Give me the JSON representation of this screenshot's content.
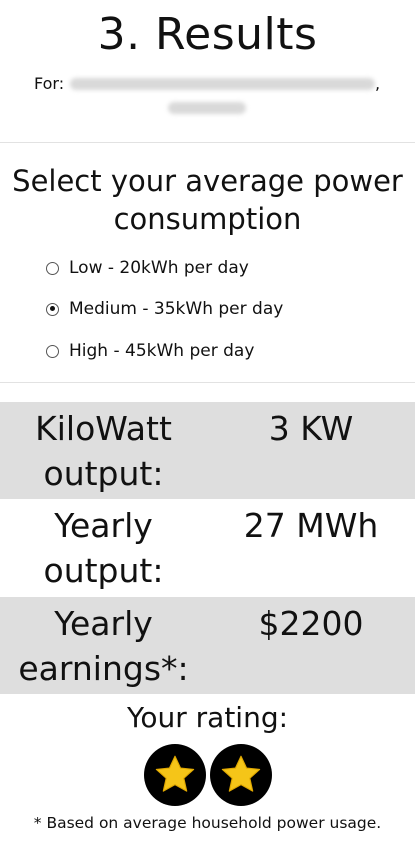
{
  "header": {
    "title": "3. Results",
    "for_label": "For:",
    "comma": ","
  },
  "consumption": {
    "title": "Select your average power consumption",
    "options": [
      {
        "label": "Low - 20kWh per day",
        "checked": false
      },
      {
        "label": "Medium - 35kWh per day",
        "checked": true
      },
      {
        "label": "High - 45kWh per day",
        "checked": false
      }
    ]
  },
  "results": [
    {
      "label_line1": "KiloWatt",
      "label_line2": "output:",
      "value": "3 KW"
    },
    {
      "label_line1": "Yearly",
      "label_line2": "output:",
      "value": "27 MWh"
    },
    {
      "label_line1": "Yearly",
      "label_line2": "earnings*:",
      "value": "$2200"
    }
  ],
  "rating": {
    "title": "Your rating:",
    "stars": 2,
    "star_icon": "star-icon",
    "badge_color": "#000000",
    "star_color": "#f5c518"
  },
  "footnote": "* Based on average household power usage.",
  "colors": {
    "shaded_row": "#dedede",
    "divider": "#e2e2e2"
  }
}
